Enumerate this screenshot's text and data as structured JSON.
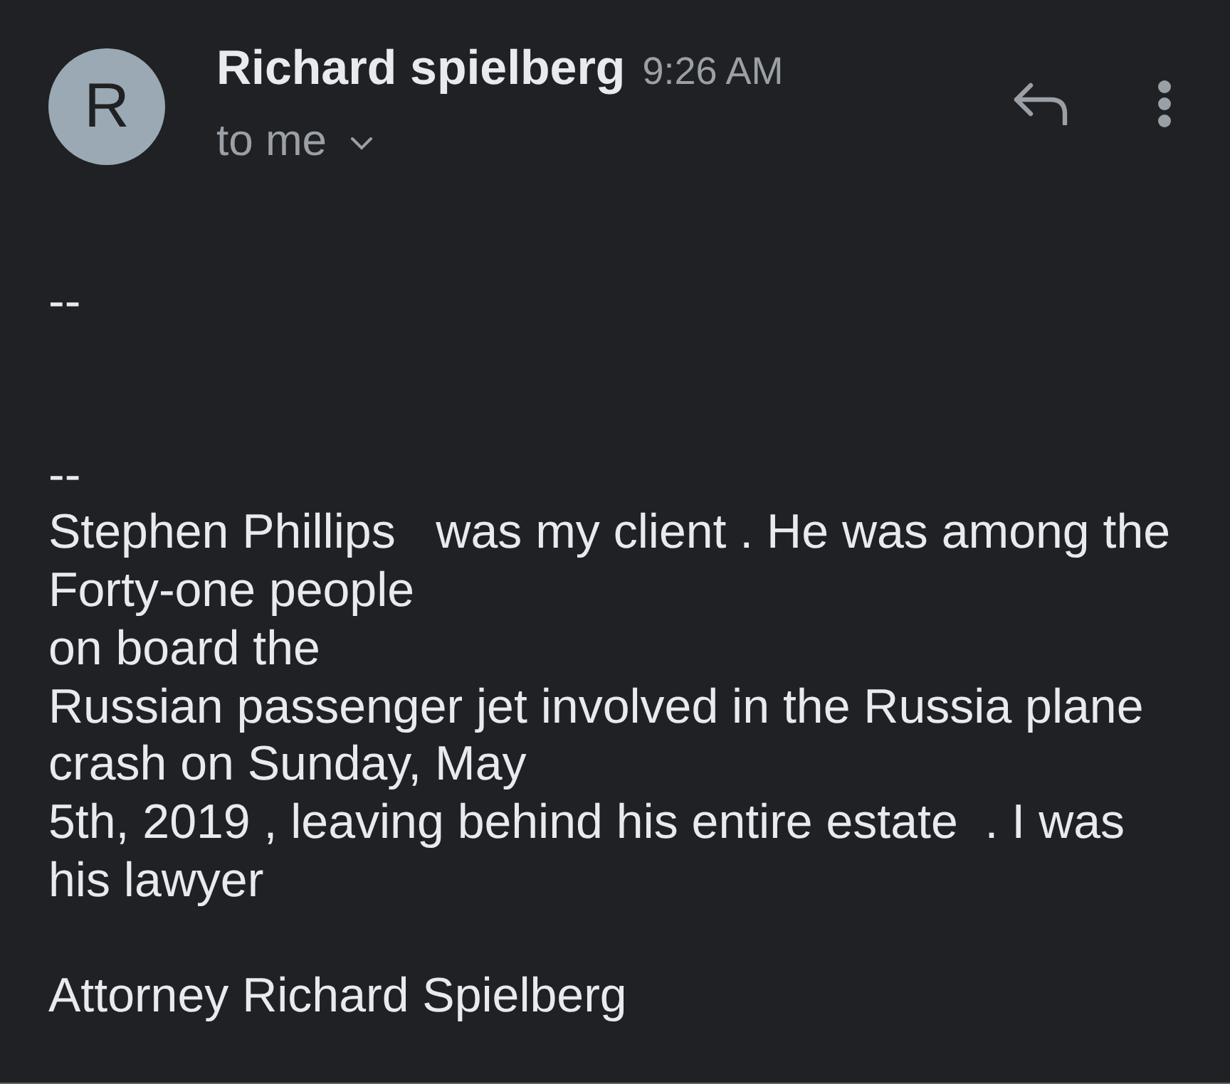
{
  "header": {
    "avatar": {
      "initial": "R"
    },
    "sender": "Richard spielberg",
    "time": "9:26 AM",
    "recipient": "to me",
    "details_expanded": false
  },
  "body": {
    "blocks": [
      {
        "kind": "separator",
        "text": "--"
      },
      {
        "kind": "message",
        "text": "--\nStephen Phillips   was my client . He was among the\nForty-one people\non board the\nRussian passenger jet involved in the Russia plane\ncrash on Sunday, May\n5th, 2019 , leaving behind his entire estate  . I was\nhis lawyer"
      },
      {
        "kind": "signature",
        "text": "Attorney Richard Spielberg"
      }
    ]
  }
}
